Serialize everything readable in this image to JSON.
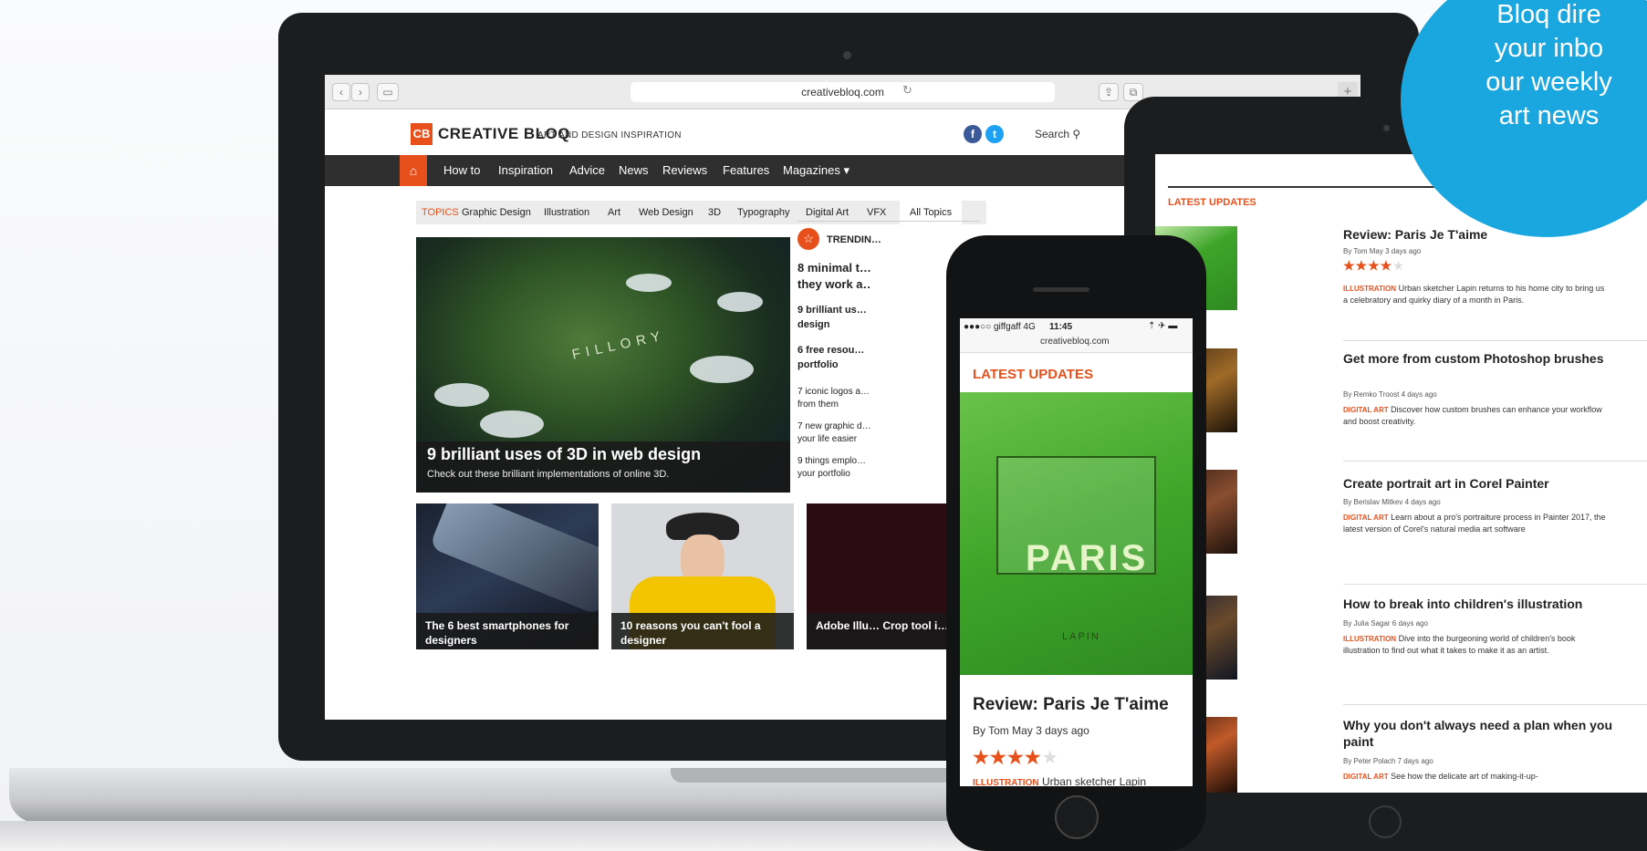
{
  "browser": {
    "url": "creativebloq.com",
    "back_icon": "chevron-left-icon",
    "forward_icon": "chevron-right-icon",
    "sidebar_icon": "sidebar-icon",
    "reload_icon": "reload-icon",
    "share_icon": "share-icon",
    "tabs_icon": "tabs-icon",
    "new_tab_label": "+"
  },
  "site": {
    "logo_mark": "CB",
    "logo_text": "CREATIVE BLOQ",
    "tagline": "ART AND DESIGN INSPIRATION",
    "search_label": "Search",
    "brand_color": "#e8501b",
    "nav": [
      "How to",
      "Inspiration",
      "Advice",
      "News",
      "Reviews",
      "Features",
      "Magazines ▾"
    ],
    "topics_label": "TOPICS",
    "topics": [
      "Graphic Design",
      "Illustration",
      "Art",
      "Web Design",
      "3D",
      "Typography",
      "Digital Art",
      "VFX"
    ],
    "all_topics": "All Topics",
    "hero": {
      "map_label": "FILLORY",
      "title": "9 brilliant uses of 3D in web design",
      "subtitle": "Check out these brilliant implementations of online 3D."
    },
    "cards": [
      {
        "title": "The 6 best smartphones for designers"
      },
      {
        "title": "10 reasons you can't fool a designer"
      },
      {
        "title": "Adobe Illu… Crop tool i…"
      }
    ],
    "trending": {
      "label": "TRENDIN…",
      "items": [
        "8 minimal t…",
        "they work a…",
        "9 brilliant us…",
        "design",
        "6 free resou…",
        "portfolio",
        "7 iconic logos a…",
        "from them",
        "7 new graphic d…",
        "your life easier",
        "9 things emplo…",
        "your portfolio"
      ]
    }
  },
  "tablet": {
    "section_label": "LATEST UPDATES",
    "items": [
      {
        "title": "Review: Paris Je T'aime",
        "by": "By Tom May  3 days ago",
        "stars": "★★★★",
        "empty_star": "★",
        "category": "ILLUSTRATION",
        "desc": "Urban sketcher Lapin returns to his home city to bring us a celebratory and quirky diary of a month in Paris."
      },
      {
        "title": "Get more from custom Photoshop brushes",
        "by": "By Remko Troost  4 days ago",
        "category": "DIGITAL ART",
        "desc": "Discover how custom brushes can enhance your workflow and boost creativity."
      },
      {
        "title": "Create portrait art in Corel Painter",
        "by": "By Berislav Mitkev  4 days ago",
        "category": "DIGITAL ART",
        "desc": "Learn about a pro's portraiture process in Painter 2017, the latest version of Corel's natural media art software"
      },
      {
        "title": "How to break into children's illustration",
        "by": "By Julia Sagar  6 days ago",
        "category": "ILLUSTRATION",
        "desc": "Dive into the burgeoning world of children's book illustration to find out what it takes to make it as an artist."
      },
      {
        "title": "Why you don't always need a plan when you paint",
        "by": "By Peter Polach  7 days ago",
        "category": "DIGITAL ART",
        "desc": "See how the delicate art of making-it-up-"
      }
    ]
  },
  "phone": {
    "carrier": "●●●○○ giffgaff  4G",
    "time": "11:45",
    "status_icons": "⇡ ✈ ▬",
    "url": "creativebloq.com",
    "section_label": "LATEST UPDATES",
    "img_text": "PARIS",
    "img_small": "LAPIN",
    "article_title": "Review: Paris Je T'aime",
    "by": "By Tom May  3 days ago",
    "stars": "★★★★",
    "empty_star": "★",
    "category": "ILLUSTRATION",
    "desc": "Urban sketcher Lapin"
  },
  "promo": {
    "text": "Bloq dire\nyour inbo\nour weekly\nart news",
    "color": "#1aa7e0"
  }
}
